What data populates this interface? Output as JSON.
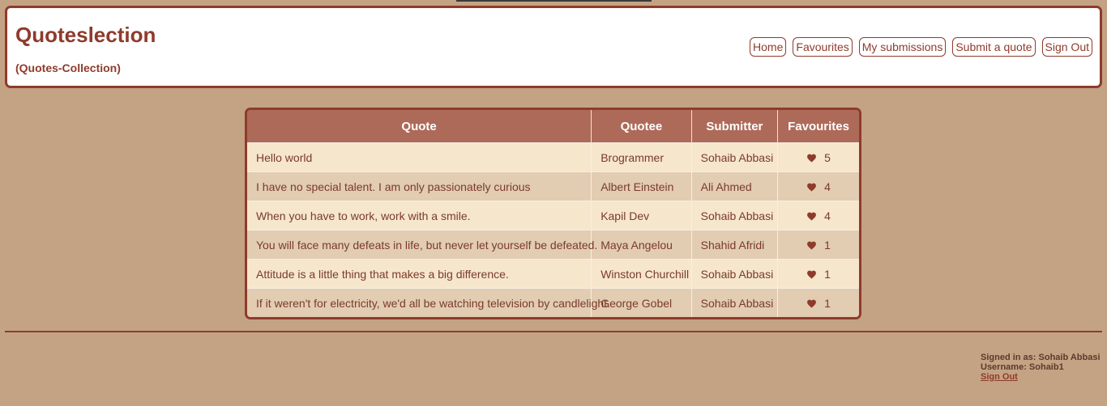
{
  "header": {
    "title": "Quoteslection",
    "subtitle": "(Quotes-Collection)",
    "nav": [
      "Home",
      "Favourites",
      "My submissions",
      "Submit a quote",
      "Sign Out"
    ]
  },
  "table": {
    "columns": [
      "Quote",
      "Quotee",
      "Submitter",
      "Favourites"
    ],
    "rows": [
      {
        "quote": "Hello world",
        "quotee": "Brogrammer",
        "submitter": "Sohaib Abbasi",
        "favourites": "5"
      },
      {
        "quote": "I have no special talent. I am only passionately curious",
        "quotee": "Albert Einstein",
        "submitter": "Ali Ahmed",
        "favourites": "4"
      },
      {
        "quote": "When you have to work, work with a smile.",
        "quotee": "Kapil Dev",
        "submitter": "Sohaib Abbasi",
        "favourites": "4"
      },
      {
        "quote": "You will face many defeats in life, but never let yourself be defeated.",
        "quotee": "Maya Angelou",
        "submitter": "Shahid Afridi",
        "favourites": "1"
      },
      {
        "quote": "Attitude is a little thing that makes a big difference.",
        "quotee": "Winston Churchill",
        "submitter": "Sohaib Abbasi",
        "favourites": "1"
      },
      {
        "quote": "If it weren't for electricity, we'd all be watching television by candlelight.",
        "quotee": "George Gobel",
        "submitter": "Sohaib Abbasi",
        "favourites": "1"
      }
    ],
    "favourite_icon": "heart-icon"
  },
  "footer": {
    "signed_in": "Signed in as: Sohaib Abbasi",
    "username": "Username: Sohaib1",
    "sign_out": "Sign Out"
  },
  "colors": {
    "background": "#c4a384",
    "accent": "#8e3b2c",
    "table_header": "#ae6a59",
    "row_light": "#f6e6cc",
    "row_dark": "#e2ccb2"
  }
}
